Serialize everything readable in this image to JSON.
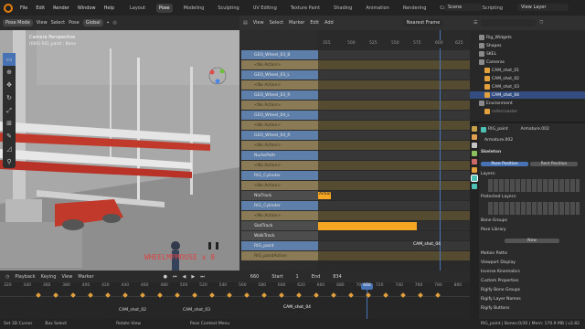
{
  "topbar": {
    "menu": [
      "File",
      "Edit",
      "Render",
      "Window",
      "Help"
    ],
    "tabs": [
      "Layout",
      "Pose",
      "Modeling",
      "Sculpting",
      "UV Editing",
      "Texture Paint",
      "Shading",
      "Animation",
      "Rendering",
      "Compositing",
      "Scripting"
    ],
    "active_tab": "Pose",
    "scene": "Scene",
    "view_layer": "View Layer"
  },
  "viewport": {
    "mode": "Pose Mode",
    "menu": [
      "View",
      "Select",
      "Pose"
    ],
    "transform": "Global",
    "camera_title": "Camera Perspective",
    "camera_sub": "(660) RIG_paint : Bone",
    "overlay_text": "WHEELMPMOUSE x 8"
  },
  "nla": {
    "menu": [
      "View",
      "Select",
      "Marker",
      "Edit",
      "Add"
    ],
    "frame_mode": "Nearest Frame",
    "ruler": [
      "355",
      "500",
      "525",
      "550",
      "575",
      "600",
      "625",
      "650"
    ],
    "tracks": [
      {
        "label": "GEO_Wheel_03_B",
        "kind": "obj"
      },
      {
        "label": "<No Action>",
        "kind": "act"
      },
      {
        "label": "GEO_Wheel_03_L",
        "kind": "obj"
      },
      {
        "label": "<No Action>",
        "kind": "act"
      },
      {
        "label": "GEO_Wheel_03_R",
        "kind": "obj"
      },
      {
        "label": "<No Action>",
        "kind": "act"
      },
      {
        "label": "GEO_Wheel_04_L",
        "kind": "obj"
      },
      {
        "label": "<No Action>",
        "kind": "act"
      },
      {
        "label": "GEO_Wheel_04_R",
        "kind": "obj"
      },
      {
        "label": "<No Action>",
        "kind": "act"
      },
      {
        "label": "NurbsPath",
        "kind": "obj"
      },
      {
        "label": "<No Action>",
        "kind": "act"
      },
      {
        "label": "RIG_Cylinder",
        "kind": "obj"
      },
      {
        "label": "<No Action>",
        "kind": "act"
      },
      {
        "label": "NlaTrack",
        "kind": "track"
      },
      {
        "label": "RIG_Cylinder",
        "kind": "obj"
      },
      {
        "label": "<No Action>",
        "kind": "act"
      },
      {
        "label": "SlotTrack",
        "kind": "track"
      },
      {
        "label": "WalkTrack",
        "kind": "track"
      },
      {
        "label": "RIG_paint",
        "kind": "obj"
      },
      {
        "label": "RIG_paintAction",
        "kind": "act"
      }
    ],
    "strip_action": "Action",
    "marker_label": "CAM_shot_04"
  },
  "timeline": {
    "menu": [
      "Playback",
      "Keying",
      "View",
      "Marker"
    ],
    "current_frame": "660",
    "start_label": "Start",
    "start": "1",
    "end_label": "End",
    "end": "834",
    "ruler": [
      "320",
      "340",
      "360",
      "380",
      "400",
      "420",
      "440",
      "460",
      "480",
      "500",
      "520",
      "540",
      "560",
      "580",
      "600",
      "620",
      "660",
      "680",
      "700",
      "720",
      "740",
      "760",
      "780",
      "800"
    ],
    "markers": [
      "CAM_shot_02",
      "CAM_shot_03",
      "CAM_shot_04"
    ]
  },
  "outliner": {
    "items": [
      {
        "label": "Rig_Widgets",
        "indent": 1,
        "color": "#d8d8d8",
        "sel": false
      },
      {
        "label": "Shapes",
        "indent": 1,
        "color": "#d8d8d8",
        "sel": false
      },
      {
        "label": "SKEL",
        "indent": 1,
        "color": "#d8d8d8",
        "sel": false
      },
      {
        "label": "Cameras",
        "indent": 1,
        "color": "#d8d8d8",
        "sel": false
      },
      {
        "label": "CAM_shot_01",
        "indent": 2,
        "color": "#d8d8d8",
        "sel": false
      },
      {
        "label": "CAM_shot_02",
        "indent": 2,
        "color": "#d8d8d8",
        "sel": false
      },
      {
        "label": "CAM_shot_03",
        "indent": 2,
        "color": "#d8d8d8",
        "sel": false
      },
      {
        "label": "CAM_shot_04",
        "indent": 2,
        "color": "#ffffff",
        "sel": true
      },
      {
        "label": "Environment",
        "indent": 1,
        "color": "#d8d8d8",
        "sel": false
      },
      {
        "label": "rollercoaster",
        "indent": 2,
        "color": "#8a8a8a",
        "sel": false
      }
    ]
  },
  "properties": {
    "object": "RIG_paint",
    "armature": "Armature.002",
    "data_name": "Armature.002",
    "skeleton": "Skeleton",
    "pose_position": "Pose Position",
    "rest_position": "Rest Position",
    "layers": "Layers:",
    "protected_layers": "Protected Layers:",
    "bone_groups": "Bone Groups",
    "pose_library": "Pose Library",
    "new": "New",
    "sections": [
      "Motion Paths",
      "Viewport Display",
      "Inverse Kinematics",
      "Custom Properties",
      "Rigify Bone Groups",
      "Rigify Layer Names",
      "Rigify Buttons"
    ]
  },
  "statusbar": {
    "items": [
      "Set 3D Cursor",
      "Box Select",
      "Rotate View",
      "Pose Context Menu"
    ],
    "right": "RIG_paint | Bones:0/30 | Mem: 170.9 MB | v2.82"
  },
  "colors": {
    "accent": "#4772b3",
    "orange": "#f5a623",
    "selection": "#334d80"
  }
}
